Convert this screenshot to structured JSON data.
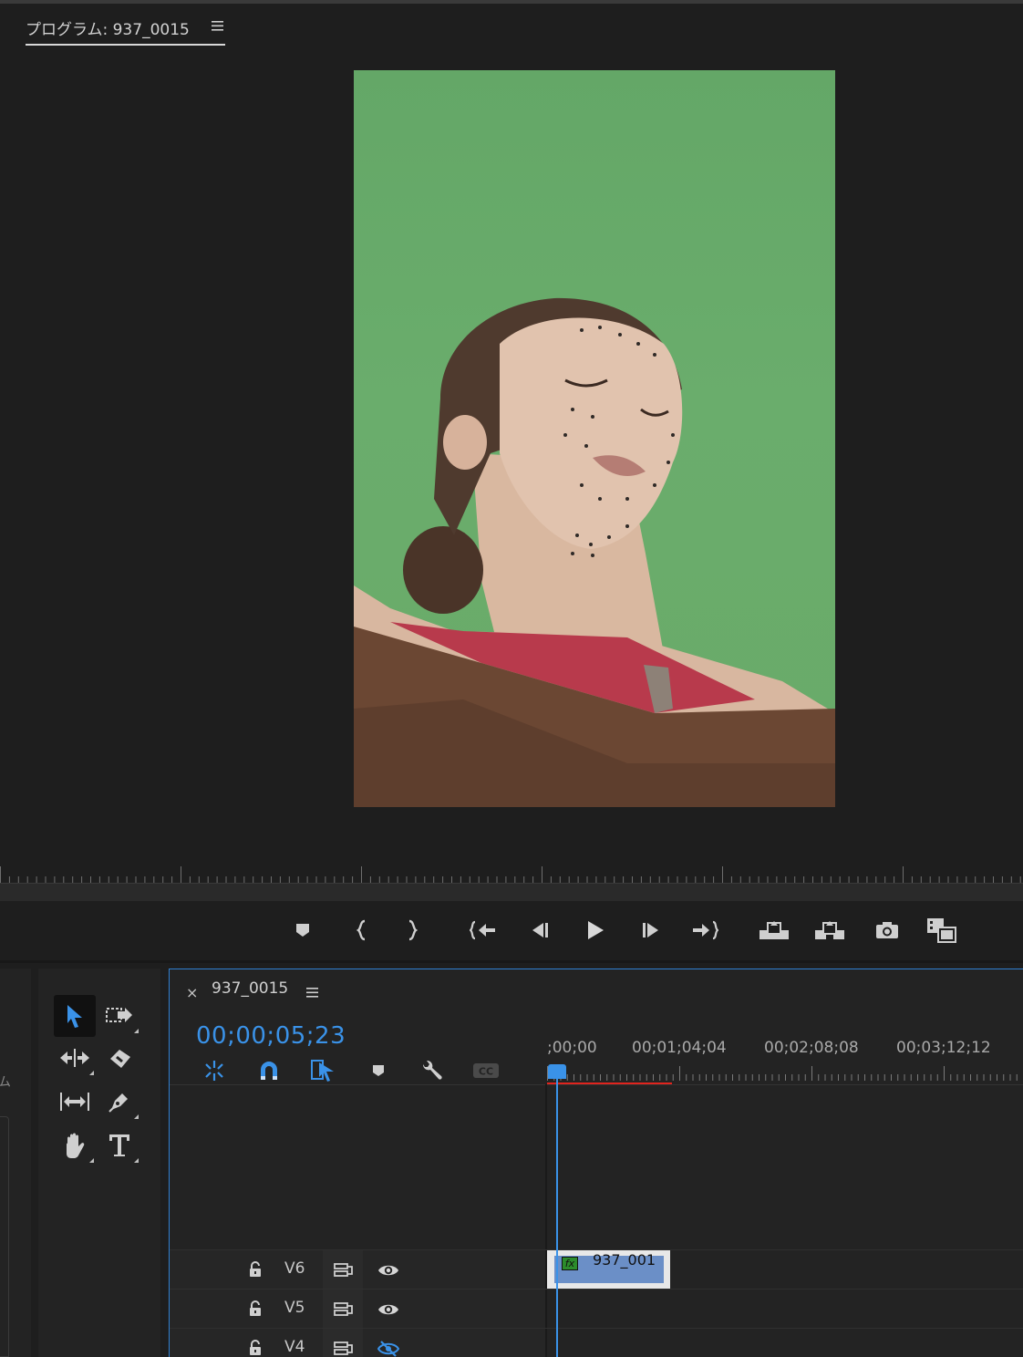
{
  "program_monitor": {
    "title": "プログラム: 937_0015",
    "menu_icon": "hamburger-icon"
  },
  "transport": {
    "buttons": [
      "marker-icon",
      "mark-in-icon",
      "mark-out-icon",
      "go-to-in-icon",
      "step-back-icon",
      "play-icon",
      "step-forward-icon",
      "go-to-out-icon",
      "lift-icon",
      "extract-icon",
      "export-frame-icon",
      "comparison-view-icon"
    ]
  },
  "tools": [
    "selection-tool-icon",
    "track-select-forward-icon",
    "ripple-edit-icon",
    "razor-icon",
    "slip-icon",
    "pen-icon",
    "hand-icon",
    "type-icon"
  ],
  "left_panel": {
    "glyph": "ム"
  },
  "timeline": {
    "sequence_name": "937_0015",
    "close_label": "×",
    "timecode": "00;00;05;23",
    "ruler_labels": [
      ";00;00",
      "00;01;04;04",
      "00;02;08;08",
      "00;03;12;12"
    ],
    "tracks": [
      {
        "name": "V6",
        "visible": true
      },
      {
        "name": "V5",
        "visible": true
      },
      {
        "name": "V4",
        "visible": false
      }
    ],
    "clip": {
      "name": "937_001",
      "fx_label": "fx",
      "color": "#6b8fc7"
    }
  },
  "colors": {
    "accent": "#3a92e8",
    "work_area": "#e0241e",
    "chroma_green": "#68aa6a"
  }
}
